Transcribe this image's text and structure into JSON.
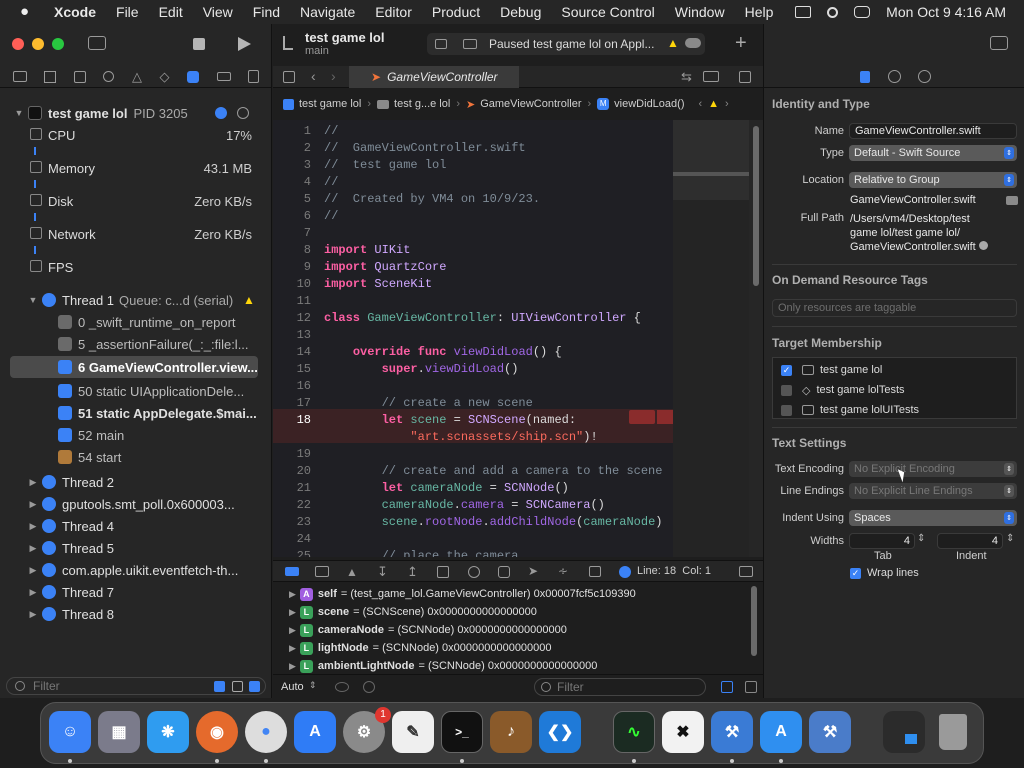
{
  "menubar": {
    "items": [
      "Xcode",
      "File",
      "Edit",
      "View",
      "Find",
      "Navigate",
      "Editor",
      "Product",
      "Debug",
      "Source Control",
      "Window",
      "Help"
    ],
    "clock": "Mon Oct 9  4:16 AM"
  },
  "toolbar": {
    "project": "test game lol",
    "branch": "main",
    "status": "Paused test game lol on Appl..."
  },
  "navigator": {
    "process": "test game lol",
    "pid": "PID 3205",
    "gauges": [
      {
        "label": "CPU",
        "value": "17%"
      },
      {
        "label": "Memory",
        "value": "43.1 MB"
      },
      {
        "label": "Disk",
        "value": "Zero KB/s"
      },
      {
        "label": "Network",
        "value": "Zero KB/s"
      },
      {
        "label": "FPS",
        "value": ""
      }
    ],
    "thread1": {
      "label": "Thread 1",
      "queue": "Queue: c...d (serial)"
    },
    "frames": [
      "0 _swift_runtime_on_report",
      "5 _assertionFailure(_:_:file:l...",
      "6 GameViewController.view...",
      "50 static UIApplicationDele...",
      "51 static AppDelegate.$mai...",
      "52 main",
      "54 start"
    ],
    "threads": [
      "Thread 2",
      "gputools.smt_poll.0x600003...",
      "Thread 4",
      "Thread 5",
      "com.apple.uikit.eventfetch-th...",
      "Thread 7",
      "Thread 8"
    ],
    "filter_placeholder": "Filter"
  },
  "editor": {
    "tab": "GameViewController",
    "breadcrumb": [
      "test game lol",
      "test g...e lol",
      "GameViewController",
      "viewDidLoad()"
    ],
    "lines": [
      {
        "n": "1",
        "code": "//"
      },
      {
        "n": "2",
        "code": "//  GameViewController.swift"
      },
      {
        "n": "3",
        "code": "//  test game lol"
      },
      {
        "n": "4",
        "code": "//"
      },
      {
        "n": "5",
        "code": "//  Created by VM4 on 10/9/23."
      },
      {
        "n": "6",
        "code": "//"
      },
      {
        "n": "7",
        "code": ""
      },
      {
        "n": "8",
        "code": "import UIKit"
      },
      {
        "n": "9",
        "code": "import QuartzCore"
      },
      {
        "n": "10",
        "code": "import SceneKit"
      },
      {
        "n": "11",
        "code": ""
      },
      {
        "n": "12",
        "code": "class GameViewController: UIViewController {"
      },
      {
        "n": "13",
        "code": ""
      },
      {
        "n": "14",
        "code": "    override func viewDidLoad() {"
      },
      {
        "n": "15",
        "code": "        super.viewDidLoad()"
      },
      {
        "n": "16",
        "code": ""
      },
      {
        "n": "17",
        "code": "        // create a new scene"
      },
      {
        "n": "18",
        "code": "        let scene = SCNScene(named:"
      },
      {
        "n": "",
        "code": "            \"art.scnassets/ship.scn\")!"
      },
      {
        "n": "19",
        "code": ""
      },
      {
        "n": "20",
        "code": "        // create and add a camera to the scene"
      },
      {
        "n": "21",
        "code": "        let cameraNode = SCNNode()"
      },
      {
        "n": "22",
        "code": "        cameraNode.camera = SCNCamera()"
      },
      {
        "n": "23",
        "code": "        scene.rootNode.addChildNode(cameraNode)"
      },
      {
        "n": "24",
        "code": ""
      },
      {
        "n": "25",
        "code": "        // place the camera"
      }
    ],
    "debugbar": {
      "position": "Line: 18  Col: 1"
    },
    "variables": [
      {
        "badge": "A",
        "name": "self",
        "value": "= (test_game_lol.GameViewController) 0x00007fcf5c109390"
      },
      {
        "badge": "L",
        "name": "scene",
        "value": "= (SCNScene) 0x0000000000000000"
      },
      {
        "badge": "L",
        "name": "cameraNode",
        "value": "= (SCNNode) 0x0000000000000000"
      },
      {
        "badge": "L",
        "name": "lightNode",
        "value": "= (SCNNode) 0x0000000000000000"
      },
      {
        "badge": "L",
        "name": "ambientLightNode",
        "value": "= (SCNNode) 0x0000000000000000"
      }
    ],
    "bottom": {
      "auto": "Auto",
      "filter_placeholder": "Filter"
    }
  },
  "inspector": {
    "identity_header": "Identity and Type",
    "name_label": "Name",
    "name_value": "GameViewController.swift",
    "type_label": "Type",
    "type_value": "Default - Swift Source",
    "location_label": "Location",
    "location_value": "Relative to Group",
    "location_file": "GameViewController.swift",
    "fullpath_label": "Full Path",
    "fullpath_lines": [
      "/Users/vm4/Desktop/test",
      "game lol/test game lol/",
      "GameViewController.swift"
    ],
    "tags_header": "On Demand Resource Tags",
    "tags_placeholder": "Only resources are taggable",
    "target_header": "Target Membership",
    "targets": [
      {
        "name": "test game lol",
        "checked": true
      },
      {
        "name": "test game lolTests",
        "checked": false
      },
      {
        "name": "test game lolUITests",
        "checked": false
      }
    ],
    "text_header": "Text Settings",
    "encoding_label": "Text Encoding",
    "encoding_value": "No Explicit Encoding",
    "endings_label": "Line Endings",
    "endings_value": "No Explicit Line Endings",
    "indent_label": "Indent Using",
    "indent_value": "Spaces",
    "widths_label": "Widths",
    "tab_value": "4",
    "indent_width_value": "4",
    "tab_caption": "Tab",
    "indent_caption": "Indent",
    "wrap_label": "Wrap lines"
  },
  "dock": {
    "apps": [
      "Finder",
      "Launchpad",
      "Safari",
      "Firefox",
      "Chrome",
      "App Store",
      "System Settings",
      "TextEdit",
      "Terminal",
      "Instruments",
      "VS Code",
      "Activity Monitor",
      "CapCut",
      "Xcode",
      "Simulator",
      "Xcode Beta",
      "Downloads",
      "Trash"
    ],
    "settings_badge": "1"
  }
}
